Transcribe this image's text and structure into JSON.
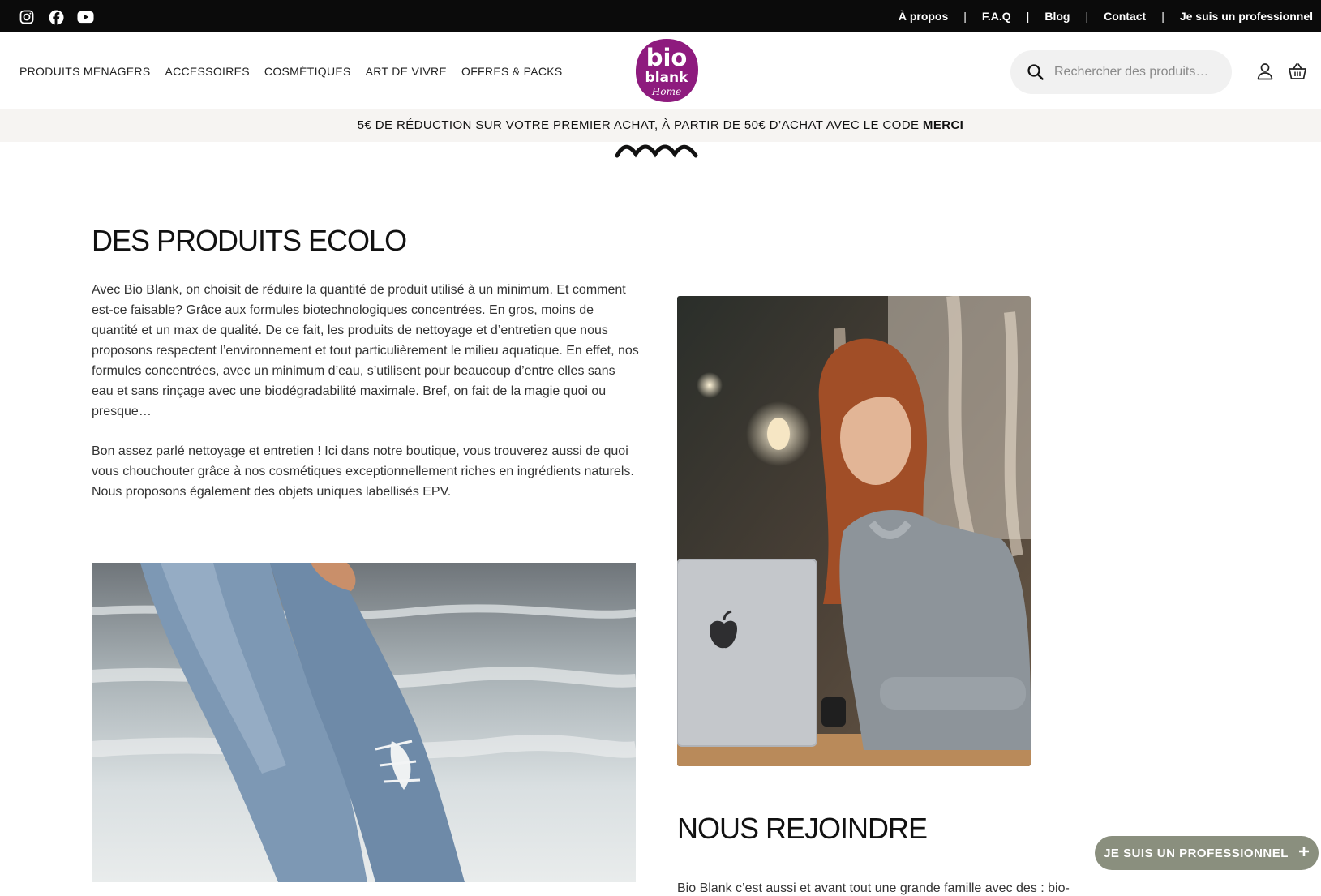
{
  "topbar": {
    "social_icons": [
      "instagram-icon",
      "facebook-icon",
      "youtube-icon"
    ],
    "links": [
      "À propos",
      "F.A.Q",
      "Blog",
      "Contact",
      "Je suis un professionnel"
    ],
    "separator": "|"
  },
  "nav": {
    "items": [
      "PRODUITS MÉNAGERS",
      "ACCESSOIRES",
      "COSMÉTIQUES",
      "ART DE VIVRE",
      "OFFRES & PACKS"
    ]
  },
  "logo": {
    "line1": "bio",
    "line2": "blank",
    "line3": "Home",
    "color": "#8e1b7e"
  },
  "search": {
    "placeholder": "Rechercher des produits…"
  },
  "header_icons": [
    "user-icon",
    "basket-icon"
  ],
  "promo": {
    "text": "5€ DE RÉDUCTION SUR VOTRE PREMIER ACHAT, À PARTIR DE 50€ D’ACHAT AVEC LE CODE ",
    "code": "MERCI"
  },
  "section1": {
    "title": "DES PRODUITS ECOLO",
    "paragraph1": "Avec Bio Blank, on choisit de réduire la quantité de produit utilisé à un minimum. Et comment est-ce faisable? Grâce aux formules biotechnologiques concentrées. En gros, moins de quantité et un max de qualité. De ce fait, les produits de nettoyage et d’entretien que nous proposons respectent l’environnement et tout particulièrement le milieu aquatique. En effet, nos formules concentrées, avec un minimum d’eau, s’utilisent pour beaucoup d’entre elles sans eau et sans rinçage avec une biodégradabilité maximale. Bref, on fait de la magie quoi ou presque…",
    "paragraph2": "Bon assez parlé nettoyage et entretien ! Ici dans notre boutique, vous trouverez aussi de quoi vous chouchouter grâce à nos cosmétiques exceptionnellement riches en ingrédients naturels. Nous proposons également des objets uniques labellisés EPV."
  },
  "section2": {
    "title": "NOUS REJOINDRE",
    "paragraph": "Bio Blank c’est aussi et avant tout une grande famille avec des : bio-"
  },
  "pro_button": {
    "label": "JE SUIS UN PROFESSIONNEL",
    "icon": "plus-icon"
  }
}
